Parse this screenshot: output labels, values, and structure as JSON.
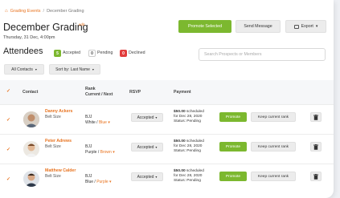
{
  "breadcrumb": {
    "home_icon": "home-icon",
    "link": "Grading Events",
    "sep": "/",
    "current": "December Grading"
  },
  "header": {
    "title": "December Grading",
    "edit": "edit",
    "subtitle": "Thursday, 31 Dec, 4:00pm"
  },
  "actions": {
    "promote_selected": "Promote Selected",
    "send_message": "Send Message",
    "export": "Export"
  },
  "attendees": {
    "title": "Attendees",
    "accepted_count": "5",
    "accepted_label": "Accepted",
    "pending_count": "0",
    "pending_label": "Pending",
    "declined_count": "0",
    "declined_label": "Declined"
  },
  "search": {
    "placeholder": "Search Prospects or Members"
  },
  "filters": {
    "contacts": "All Contacts",
    "sort": "Sort by: Last Name"
  },
  "table": {
    "headers": {
      "contact": "Contact",
      "rank_line1": "Rank",
      "rank_line2": "Current / Next",
      "rsvp": "RSVP",
      "payment": "Payment"
    },
    "rows": [
      {
        "name": "Danny Ackers",
        "belt": "Belt Size",
        "rank_code": "BJJ",
        "rank_current": "White /",
        "rank_next": "Blue",
        "rsvp": "Accepted",
        "amount": "$50.00",
        "pay_status": "scheduled",
        "pay_date": "for Dec 28, 2020",
        "pay_state": "Status: Pending",
        "promote": "Promote",
        "keep": "Keep current rank"
      },
      {
        "name": "Peter Adrews",
        "belt": "Belt Size",
        "rank_code": "BJJ",
        "rank_current": "Purple /",
        "rank_next": "Brown",
        "rsvp": "Accepted",
        "amount": "$50.00",
        "pay_status": "scheduled",
        "pay_date": "for Dec 28, 2020",
        "pay_state": "Status: Pending",
        "promote": "Promote",
        "keep": "Keep current rank"
      },
      {
        "name": "Matthew Calder",
        "belt": "Belt Size",
        "rank_code": "BJJ",
        "rank_current": "Blue /",
        "rank_next": "Purple",
        "rsvp": "Accepted",
        "amount": "$50.00",
        "pay_status": "scheduled",
        "pay_date": "for Dec 28, 2020",
        "pay_state": "Status: Pending",
        "promote": "Promote",
        "keep": "Keep current rank"
      }
    ]
  },
  "colors": {
    "accent": "#e8731f",
    "green": "#7cb82f",
    "declined": "#e23d3d"
  }
}
